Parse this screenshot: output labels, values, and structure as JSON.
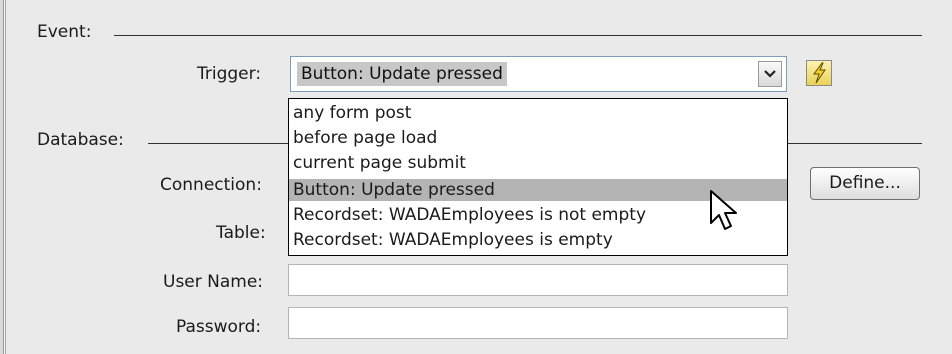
{
  "event": {
    "section_label": "Event:"
  },
  "trigger": {
    "label": "Trigger:",
    "value": "Button: Update pressed",
    "options": [
      "any form post",
      "before page load",
      "current page submit",
      "Button: Update pressed",
      "Recordset: WADAEmployees is not empty",
      "Recordset: WADAEmployees is empty"
    ],
    "highlighted_index": 3
  },
  "database": {
    "section_label": "Database:",
    "connection_label": "Connection:",
    "define_button": "Define...",
    "table_label": "Table:",
    "username_label": "User Name:",
    "username_value": "",
    "password_label": "Password:",
    "password_value": ""
  },
  "icons": {
    "trigger_icon": "lightning-bolt-icon",
    "select_arrow": "chevron-down-icon",
    "cursor": "mouse-pointer-icon"
  }
}
